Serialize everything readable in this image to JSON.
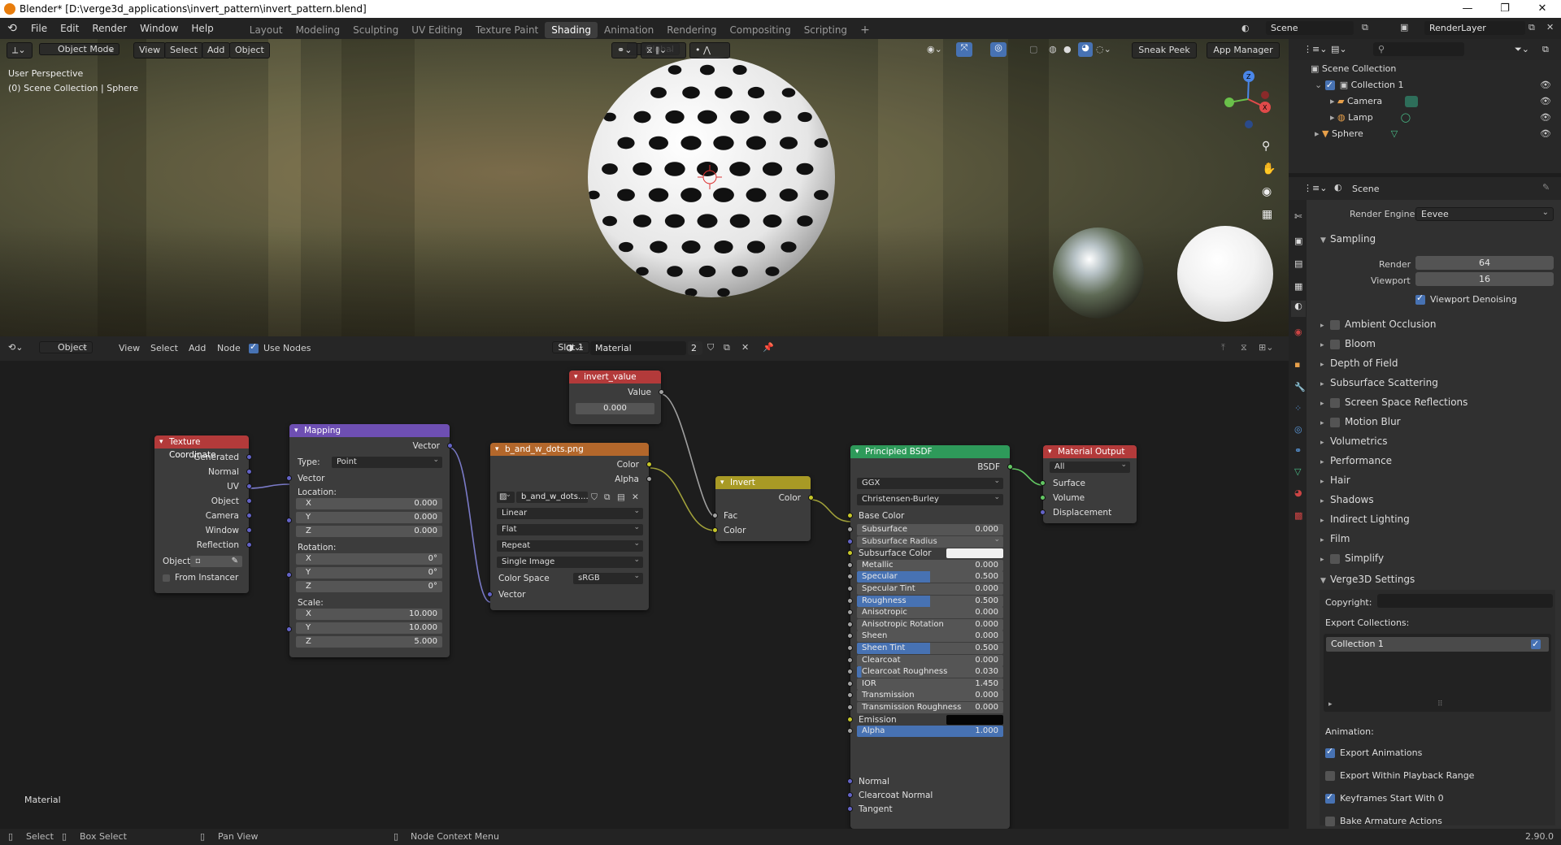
{
  "window": {
    "title": "Blender* [D:\\verge3d_applications\\invert_pattern\\invert_pattern.blend]"
  },
  "menu": [
    "File",
    "Edit",
    "Render",
    "Window",
    "Help"
  ],
  "workspaces": [
    "Layout",
    "Modeling",
    "Sculpting",
    "UV Editing",
    "Texture Paint",
    "Shading",
    "Animation",
    "Rendering",
    "Compositing",
    "Scripting"
  ],
  "active_workspace": "Shading",
  "scene_field": "Scene",
  "renderlayer_field": "RenderLayer",
  "viewport": {
    "mode": "Object Mode",
    "menus": [
      "View",
      "Select",
      "Add",
      "Object"
    ],
    "transform": "Global",
    "buttons": [
      "Sneak Peek",
      "App Manager"
    ],
    "overlay_line1": "User Perspective",
    "overlay_line2": "(0) Scene Collection | Sphere"
  },
  "node_editor": {
    "mode": "Object",
    "menus": [
      "View",
      "Select",
      "Add",
      "Node"
    ],
    "use_nodes_label": "Use Nodes",
    "slot": "Slot 1",
    "material": "Material",
    "users": "2",
    "corner_label": "Material",
    "nodes": {
      "texcoord": {
        "title": "Texture Coordinate",
        "outputs": [
          "Generated",
          "Normal",
          "UV",
          "Object",
          "Camera",
          "Window",
          "Reflection"
        ],
        "object_label": "Object",
        "from_instancer": "From Instancer"
      },
      "mapping": {
        "title": "Mapping",
        "out": "Vector",
        "type_label": "Type:",
        "type_value": "Point",
        "vector_in": "Vector",
        "location_label": "Location:",
        "rotation_label": "Rotation:",
        "scale_label": "Scale:",
        "loc": [
          [
            "X",
            "0.000"
          ],
          [
            "Y",
            "0.000"
          ],
          [
            "Z",
            "0.000"
          ]
        ],
        "rot": [
          [
            "X",
            "0°"
          ],
          [
            "Y",
            "0°"
          ],
          [
            "Z",
            "0°"
          ]
        ],
        "scale": [
          [
            "X",
            "10.000"
          ],
          [
            "Y",
            "10.000"
          ],
          [
            "Z",
            "5.000"
          ]
        ]
      },
      "image": {
        "title": "b_and_w_dots.png",
        "out_color": "Color",
        "out_alpha": "Alpha",
        "image_name": "b_and_w_dots....",
        "interp": "Linear",
        "projection": "Flat",
        "extension": "Repeat",
        "source": "Single Image",
        "colorspace_label": "Color Space",
        "colorspace": "sRGB",
        "vector_in": "Vector"
      },
      "invert_value": {
        "title": "invert_value",
        "out": "Value",
        "value": "0.000"
      },
      "invert": {
        "title": "Invert",
        "out": "Color",
        "in_fac": "Fac",
        "in_color": "Color"
      },
      "bsdf": {
        "title": "Principled BSDF",
        "out": "BSDF",
        "distribution": "GGX",
        "subsurface_method": "Christensen-Burley",
        "base_color": "Base Color",
        "subsurface_radius": "Subsurface Radius",
        "subsurface_color": "Subsurface Color",
        "emission": "Emission",
        "normal": "Normal",
        "clearcoat_normal": "Clearcoat Normal",
        "tangent": "Tangent",
        "fields": [
          {
            "label": "Subsurface",
            "value": "0.000",
            "fill": 0
          },
          {
            "label": "Metallic",
            "value": "0.000",
            "fill": 0
          },
          {
            "label": "Specular",
            "value": "0.500",
            "fill": 0.5
          },
          {
            "label": "Specular Tint",
            "value": "0.000",
            "fill": 0
          },
          {
            "label": "Roughness",
            "value": "0.500",
            "fill": 0.5
          },
          {
            "label": "Anisotropic",
            "value": "0.000",
            "fill": 0
          },
          {
            "label": "Anisotropic Rotation",
            "value": "0.000",
            "fill": 0
          },
          {
            "label": "Sheen",
            "value": "0.000",
            "fill": 0
          },
          {
            "label": "Sheen Tint",
            "value": "0.500",
            "fill": 0.5
          },
          {
            "label": "Clearcoat",
            "value": "0.000",
            "fill": 0
          },
          {
            "label": "Clearcoat Roughness",
            "value": "0.030",
            "fill": 0.03
          },
          {
            "label": "IOR",
            "value": "1.450",
            "fill": 0
          },
          {
            "label": "Transmission",
            "value": "0.000",
            "fill": 0
          },
          {
            "label": "Transmission Roughness",
            "value": "0.000",
            "fill": 0
          },
          {
            "label": "Alpha",
            "value": "1.000",
            "fill": 1
          }
        ]
      },
      "output": {
        "title": "Material Output",
        "target": "All",
        "inputs": [
          "Surface",
          "Volume",
          "Displacement"
        ]
      }
    }
  },
  "outliner": {
    "root": "Scene Collection",
    "items": [
      "Collection 1",
      "Camera",
      "Lamp",
      "Sphere"
    ]
  },
  "properties": {
    "context": "Scene",
    "render_engine_label": "Render Engine",
    "render_engine": "Eevee",
    "sampling": "Sampling",
    "render_label": "Render",
    "render_value": "64",
    "viewport_label": "Viewport",
    "viewport_value": "16",
    "viewport_denoising": "Viewport Denoising",
    "sections": [
      {
        "label": "Ambient Occlusion",
        "check": true
      },
      {
        "label": "Bloom",
        "check": true
      },
      {
        "label": "Depth of Field",
        "check": false
      },
      {
        "label": "Subsurface Scattering",
        "check": false
      },
      {
        "label": "Screen Space Reflections",
        "check": true
      },
      {
        "label": "Motion Blur",
        "check": true
      },
      {
        "label": "Volumetrics",
        "check": false
      },
      {
        "label": "Performance",
        "check": false
      },
      {
        "label": "Hair",
        "check": false
      },
      {
        "label": "Shadows",
        "check": false
      },
      {
        "label": "Indirect Lighting",
        "check": false
      },
      {
        "label": "Film",
        "check": false
      },
      {
        "label": "Simplify",
        "check": true
      }
    ],
    "verge3d": "Verge3D Settings",
    "copyright_label": "Copyright:",
    "export_collections_label": "Export Collections:",
    "export_collection": "Collection 1",
    "animation_label": "Animation:",
    "anim_opts": [
      {
        "label": "Export Animations",
        "on": true
      },
      {
        "label": "Export Within Playback Range",
        "on": false
      },
      {
        "label": "Keyframes Start With 0",
        "on": true
      },
      {
        "label": "Bake Armature Actions",
        "on": false
      }
    ]
  },
  "status": {
    "select": "Select",
    "box_select": "Box Select",
    "pan_view": "Pan View",
    "context_menu": "Node Context Menu",
    "version": "2.90.0"
  }
}
